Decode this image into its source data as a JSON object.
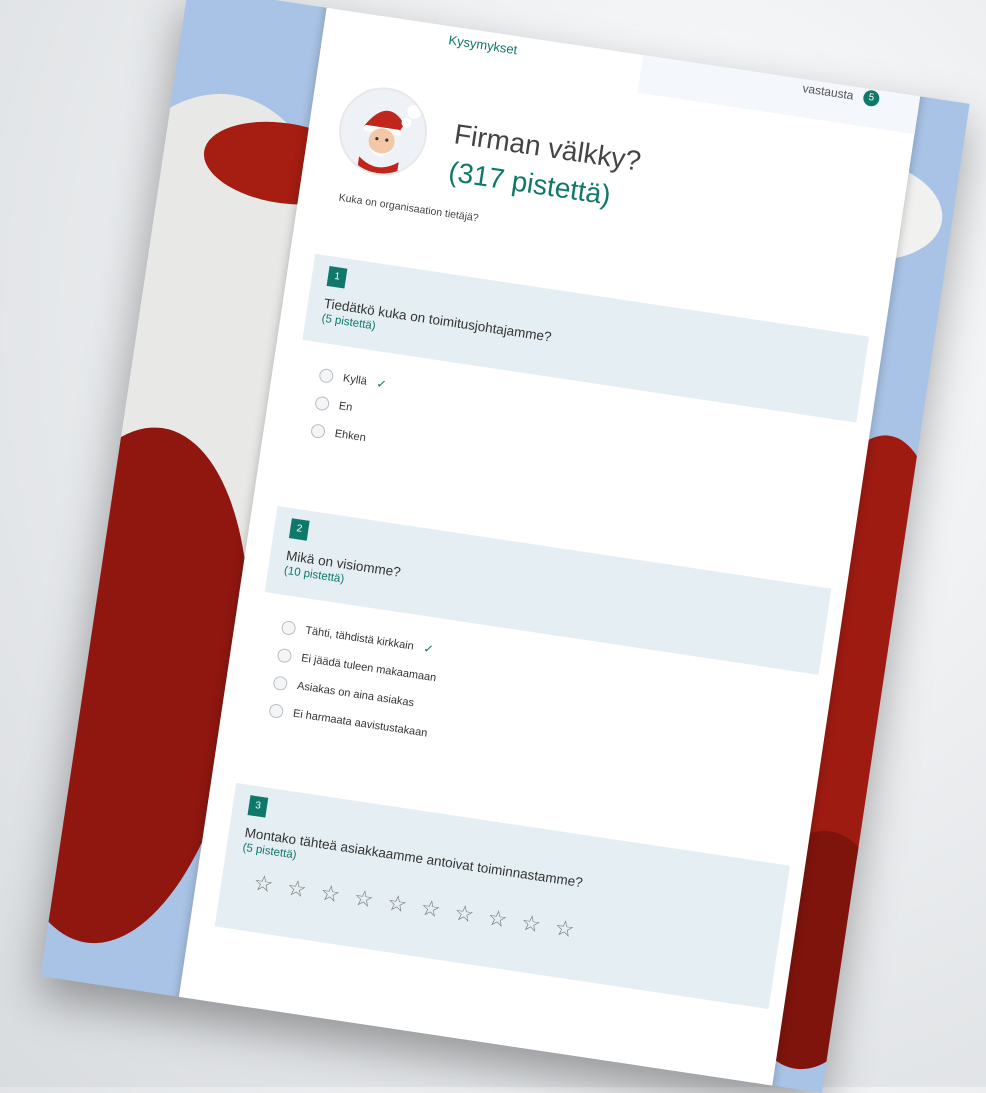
{
  "tabs": {
    "questions_label": "Kysymykset",
    "responses_label": "vastausta",
    "responses_count": "5"
  },
  "form": {
    "title": "Firman välkky?",
    "points": "(317 pistettä)",
    "subtitle": "Kuka on organisaation tietäjä?"
  },
  "questions": [
    {
      "number": "1",
      "title": "Tiedätkö kuka on toimitusjohtajamme?",
      "points": "(5 pistettä)",
      "options": [
        {
          "label": "Kyllä",
          "correct": true
        },
        {
          "label": "En",
          "correct": false
        },
        {
          "label": "Ehken",
          "correct": false
        }
      ]
    },
    {
      "number": "2",
      "title": "Mikä on visiomme?",
      "points": "(10 pistettä)",
      "options": [
        {
          "label": "Tähti, tähdistä kirkkain",
          "correct": true
        },
        {
          "label": "Ei jäädä tuleen makaamaan",
          "correct": false
        },
        {
          "label": "Asiakas on aina asiakas",
          "correct": false
        },
        {
          "label": "Ei harmaata aavistustakaan",
          "correct": false
        }
      ]
    },
    {
      "number": "3",
      "title": "Montako tähteä asiakkaamme antoivat toiminnastamme?",
      "points": "(5 pistettä)",
      "stars": "☆ ☆ ☆ ☆ ☆ ☆ ☆ ☆ ☆ ☆"
    }
  ],
  "colors": {
    "accent": "#10786a",
    "question_bg": "#e5eef2",
    "slide_bg": "#a9c3e6",
    "santa_red": "#a61d12"
  }
}
